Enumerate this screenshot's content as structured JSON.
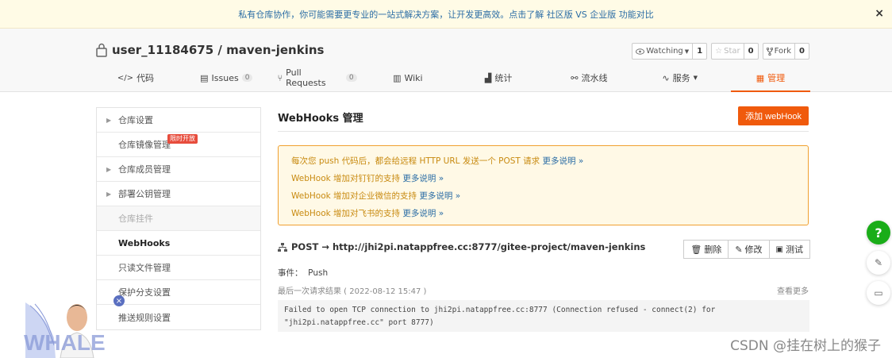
{
  "banner": {
    "text": "私有仓库协作，你可能需要更专业的一站式解决方案，让开发更高效。点击了解 社区版 VS 企业版 功能对比",
    "close_label": "×"
  },
  "repo": {
    "owner": "user_11184675",
    "separator": " / ",
    "name": "maven-jenkins",
    "watch": {
      "label": "Watching",
      "count": "1"
    },
    "star": {
      "label": "Star",
      "count": "0"
    },
    "fork": {
      "label": "Fork",
      "count": "0"
    }
  },
  "tabs": [
    {
      "label": "代码",
      "count": ""
    },
    {
      "label": "Issues",
      "count": "0"
    },
    {
      "label": "Pull Requests",
      "count": "0"
    },
    {
      "label": "Wiki",
      "count": ""
    },
    {
      "label": "统计",
      "count": ""
    },
    {
      "label": "流水线",
      "count": ""
    },
    {
      "label": "服务",
      "count": ""
    },
    {
      "label": "管理",
      "count": ""
    }
  ],
  "sidebar": {
    "items": [
      {
        "label": "仓库设置"
      },
      {
        "label": "仓库镜像管理",
        "badge": "限时开放"
      },
      {
        "label": "仓库成员管理"
      },
      {
        "label": "部署公钥管理"
      },
      {
        "label": "仓库挂件"
      },
      {
        "label": "WebHooks"
      },
      {
        "label": "只读文件管理"
      },
      {
        "label": "保护分支设置"
      },
      {
        "label": "推送规则设置"
      }
    ]
  },
  "main": {
    "title": "WebHooks 管理",
    "add_button": "添加 webHook",
    "notice": [
      {
        "text": "每次您 push 代码后，都会给远程 HTTP URL 发送一个 POST 请求 ",
        "link": "更多说明 »"
      },
      {
        "text": "WebHook 增加对钉钉的支持 ",
        "link": "更多说明 »"
      },
      {
        "text": "WebHook 增加对企业微信的支持 ",
        "link": "更多说明 »"
      },
      {
        "text": "WebHook 增加对飞书的支持 ",
        "link": "更多说明 »"
      }
    ],
    "hook_url": "POST → http://jhi2pi.natappfree.cc:8777/gitee-project/maven-jenkins",
    "delete_button": "删除",
    "edit_button": "修改",
    "test_button": "测试",
    "event": "事件：  Push",
    "last_result": "最后一次请求结果 ( 2022-08-12 15:47 )",
    "view_more": "查看更多",
    "log_line1": "Failed to open TCP connection to jhi2pi.natappfree.cc:8777 (Connection refused - connect(2) for",
    "log_line2": "\"jhi2pi.natappfree.cc\" port 8777)"
  },
  "float": {
    "help": "?"
  },
  "watermark": "CSDN @挂在树上的猴子",
  "mascot_text": "WHALE",
  "colors": {
    "accent": "#f05a0c",
    "link": "#2b6da5",
    "notice_text": "#c88a10",
    "help_green": "#1aad19"
  }
}
